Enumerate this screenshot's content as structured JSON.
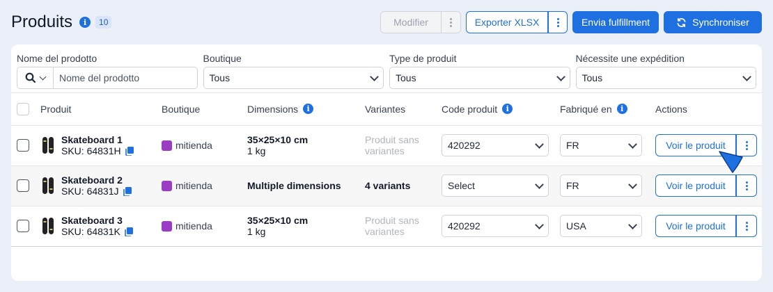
{
  "header": {
    "title": "Produits",
    "count": "10",
    "modify_label": "Modifier",
    "export_label": "Exporter XLSX",
    "fulfillment_label": "Envia fulfillment",
    "sync_label": "Synchroniser"
  },
  "filters": {
    "product_name": {
      "label": "Nome del prodotto",
      "placeholder": "Nome del prodotto"
    },
    "shop": {
      "label": "Boutique",
      "value": "Tous"
    },
    "product_type": {
      "label": "Type de produit",
      "value": "Tous"
    },
    "needs_shipping": {
      "label": "Nécessite une expédition",
      "value": "Tous"
    }
  },
  "table": {
    "columns": {
      "product": "Produit",
      "shop": "Boutique",
      "dimensions": "Dimensions",
      "variants": "Variantes",
      "code": "Code produit",
      "made_in": "Fabriqué en",
      "actions": "Actions"
    },
    "rows": [
      {
        "name": "Skateboard 1",
        "sku": "SKU: 64831H",
        "shop": "mitienda",
        "dim_main": "35×25×10 cm",
        "dim_sub": "1 kg",
        "variants": "Produit sans variantes",
        "code": "420292",
        "made_in": "FR",
        "action": "Voir le produit"
      },
      {
        "name": "Skateboard 2",
        "sku": "SKU: 64831J",
        "shop": "mitienda",
        "dim_main": "Multiple dimensions",
        "dim_sub": "",
        "variants": "4 variants",
        "code": "Select",
        "made_in": "FR",
        "action": "Voir le produit"
      },
      {
        "name": "Skateboard 3",
        "sku": "SKU: 64831K",
        "shop": "mitienda",
        "dim_main": "35×25×10 cm",
        "dim_sub": "1 kg",
        "variants": "Produit sans variantes",
        "code": "420292",
        "made_in": "USA",
        "action": "Voir le produit"
      }
    ]
  },
  "colors": {
    "primary": "#1e6fe0",
    "background": "#eaeff8",
    "shop_badge": "#9b3cc4",
    "info_badge_bg": "#d8e5fb"
  },
  "icons": [
    "info-icon",
    "search-icon",
    "chevron-down-icon",
    "copy-icon",
    "skateboard-icon",
    "sync-icon",
    "kebab-icon",
    "cursor-pointer-icon"
  ]
}
